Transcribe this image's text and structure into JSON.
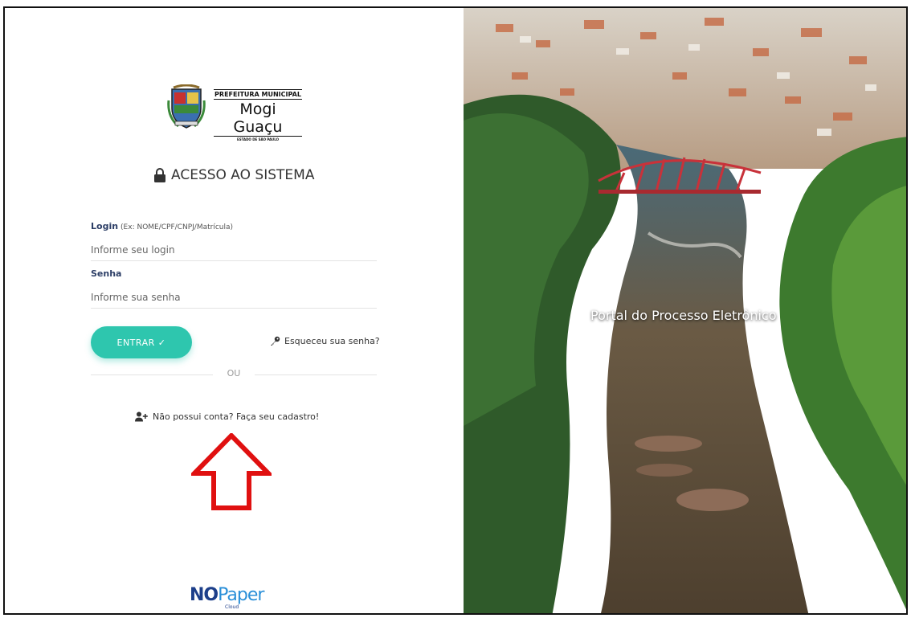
{
  "logo": {
    "line1": "PREFEITURA MUNICIPAL",
    "line2": "Mogi Guaçu",
    "line3": "ESTADO DE SÃO PAULO"
  },
  "login_panel": {
    "title": "ACESSO AO SISTEMA",
    "login_label": "Login",
    "login_hint": "(Ex: NOME/CPF/CNPJ/Matrícula)",
    "login_placeholder": "Informe seu login",
    "password_label": "Senha",
    "password_placeholder": "Informe sua senha",
    "submit_label": "ENTRAR ✓",
    "forgot_label": "Esqueceu sua senha?",
    "or_label": "OU",
    "register_label": "Não possui conta? Faça seu cadastro!"
  },
  "footer": {
    "brand_no": "NO",
    "brand_paper": "Paper",
    "brand_sub": "Cloud"
  },
  "hero": {
    "title": "Portal do Processo Eletrônico"
  },
  "colors": {
    "accent": "#2ec6ae",
    "label": "#2c3e66",
    "arrow": "#e01010",
    "brand": "#1d3f8a"
  },
  "icons": [
    "lock-icon",
    "key-icon",
    "user-plus-icon",
    "red-arrow-icon",
    "crest-icon"
  ]
}
